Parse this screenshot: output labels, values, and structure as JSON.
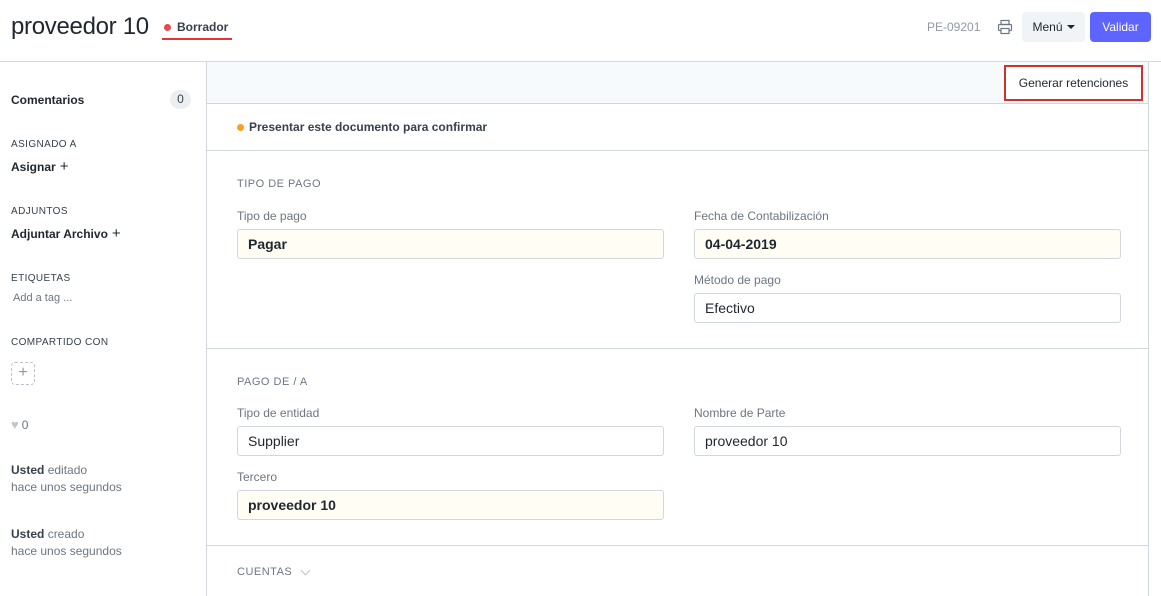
{
  "header": {
    "title": "proveedor 10",
    "status": "Borrador",
    "doc_id": "PE-09201",
    "menu_label": "Menú",
    "validate_label": "Validar"
  },
  "sidebar": {
    "comments_label": "Comentarios",
    "comments_count": "0",
    "assigned_section": "ASIGNADO A",
    "assign_label": "Asignar",
    "attachments_section": "ADJUNTOS",
    "attach_label": "Adjuntar Archivo",
    "tags_section": "ETIQUETAS",
    "add_tag_label": "Add a tag ...",
    "shared_section": "COMPARTIDO CON",
    "likes_count": "0",
    "activity": [
      {
        "user": "Usted",
        "action": "editado",
        "time": "hace unos segundos"
      },
      {
        "user": "Usted",
        "action": "creado",
        "time": "hace unos segundos"
      }
    ]
  },
  "toolbar": {
    "generate_label": "Generar retenciones"
  },
  "alert": {
    "message": "Presentar este documento para confirmar"
  },
  "sections": {
    "payment_type": {
      "title": "TIPO DE PAGO",
      "payment_type_label": "Tipo de pago",
      "payment_type_value": "Pagar",
      "posting_date_label": "Fecha de Contabilización",
      "posting_date_value": "04-04-2019",
      "payment_method_label": "Método de pago",
      "payment_method_value": "Efectivo"
    },
    "party": {
      "title": "PAGO DE / A",
      "entity_type_label": "Tipo de entidad",
      "entity_type_value": "Supplier",
      "party_name_label": "Nombre de Parte",
      "party_name_value": "proveedor 10",
      "third_party_label": "Tercero",
      "third_party_value": "proveedor 10"
    },
    "accounts": {
      "title": "CUENTAS"
    }
  },
  "colors": {
    "primary": "#5e64ff",
    "status_red": "#e24c4c",
    "alert_orange": "#ff9f1a",
    "highlight_border": "#d0312d",
    "required_bg": "#fffdf4"
  },
  "icons": {
    "print": "printer-icon",
    "caret": "caret-down-icon",
    "heart": "heart-icon",
    "plus": "plus-icon",
    "chevron": "chevron-down-icon"
  }
}
